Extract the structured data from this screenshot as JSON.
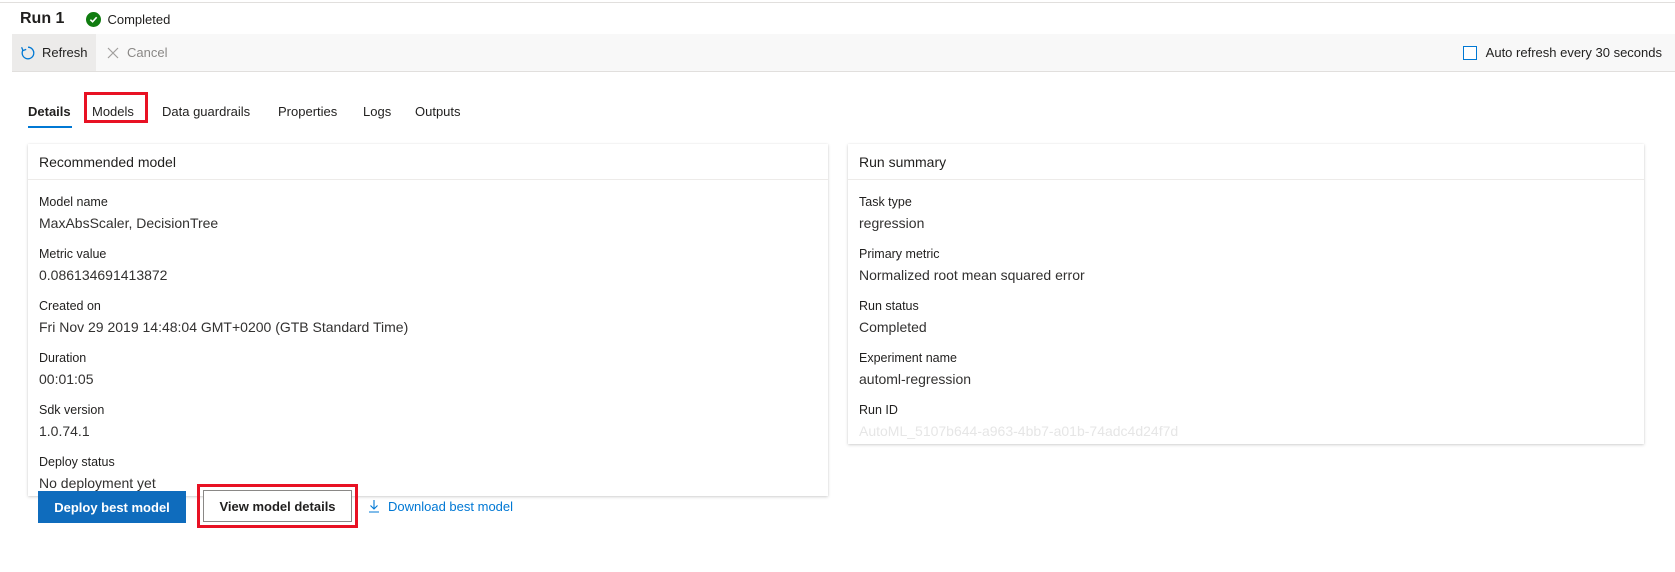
{
  "header": {
    "title": "Run 1",
    "status": "Completed"
  },
  "toolbar": {
    "refresh_label": "Refresh",
    "cancel_label": "Cancel",
    "auto_refresh_label": "Auto refresh every 30 seconds",
    "auto_refresh_checked": false
  },
  "tabs": [
    {
      "label": "Details",
      "active": true
    },
    {
      "label": "Models",
      "active": false
    },
    {
      "label": "Data guardrails",
      "active": false
    },
    {
      "label": "Properties",
      "active": false
    },
    {
      "label": "Logs",
      "active": false
    },
    {
      "label": "Outputs",
      "active": false
    }
  ],
  "recommended_model": {
    "title": "Recommended model",
    "fields": [
      {
        "label": "Model name",
        "value": "MaxAbsScaler, DecisionTree"
      },
      {
        "label": "Metric value",
        "value": "0.086134691413872"
      },
      {
        "label": "Created on",
        "value": "Fri Nov 29 2019 14:48:04 GMT+0200 (GTB Standard Time)"
      },
      {
        "label": "Duration",
        "value": "00:01:05"
      },
      {
        "label": "Sdk version",
        "value": "1.0.74.1"
      },
      {
        "label": "Deploy status",
        "value": "No deployment yet"
      }
    ]
  },
  "run_summary": {
    "title": "Run summary",
    "fields": [
      {
        "label": "Task type",
        "value": "regression"
      },
      {
        "label": "Primary metric",
        "value": "Normalized root mean squared error"
      },
      {
        "label": "Run status",
        "value": "Completed"
      },
      {
        "label": "Experiment name",
        "value": "automl-regression"
      },
      {
        "label": "Run ID",
        "value": "AutoML_5107b644-a963-4bb7-a01b-74adc4d24f7d"
      }
    ]
  },
  "actions": {
    "deploy_label": "Deploy best model",
    "view_details_label": "View model details",
    "download_label": "Download best model"
  },
  "icons": {
    "status": "check-circle-icon",
    "refresh": "refresh-icon",
    "cancel": "close-icon",
    "download": "download-icon"
  },
  "colors": {
    "accent": "#0078d4",
    "primary_button": "#0f6cbd",
    "success": "#107c10",
    "highlight": "#e81123"
  }
}
